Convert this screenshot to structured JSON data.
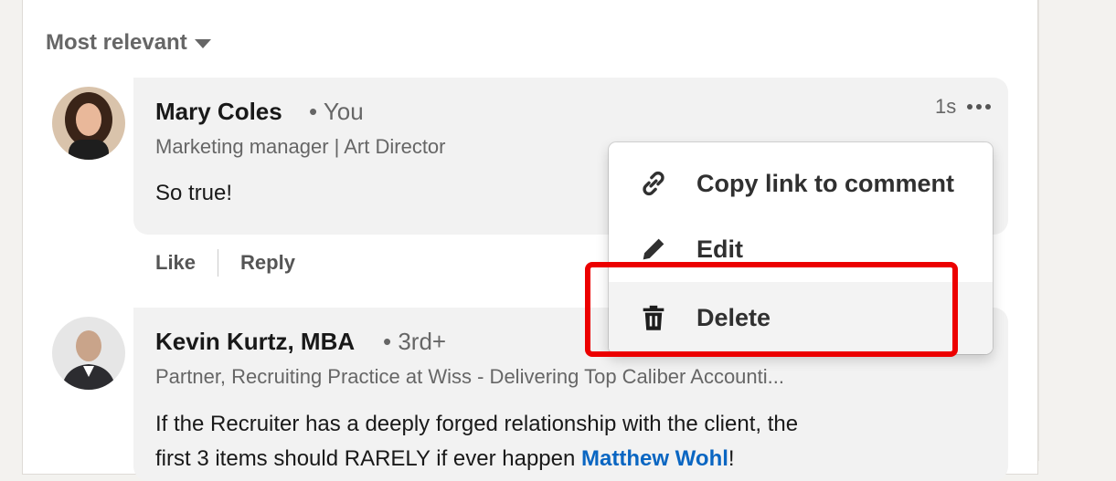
{
  "sort": {
    "label": "Most relevant"
  },
  "comments": [
    {
      "name": "Mary Coles",
      "degree": "• You",
      "headline": "Marketing manager | Art Director",
      "time": "1s",
      "text": "So true!",
      "actions": {
        "like": "Like",
        "reply": "Reply"
      }
    },
    {
      "name": "Kevin Kurtz, MBA",
      "degree": "• 3rd+",
      "headline": "Partner, Recruiting Practice at Wiss - Delivering Top Caliber Accounti...",
      "text_line1": "If the Recruiter has a deeply forged relationship with the client, the",
      "text_line2_prefix": "first 3 items should RARELY if ever happen ",
      "mention": "Matthew Wohl",
      "text_line2_suffix": "!"
    }
  ],
  "menu": {
    "items": [
      {
        "label": "Copy link to comment",
        "icon": "link-icon"
      },
      {
        "label": "Edit",
        "icon": "pencil-icon"
      },
      {
        "label": "Delete",
        "icon": "trash-icon"
      }
    ]
  },
  "colors": {
    "highlight": "#ec0000",
    "link": "#0a66c2",
    "bubble": "#f2f2f2"
  }
}
